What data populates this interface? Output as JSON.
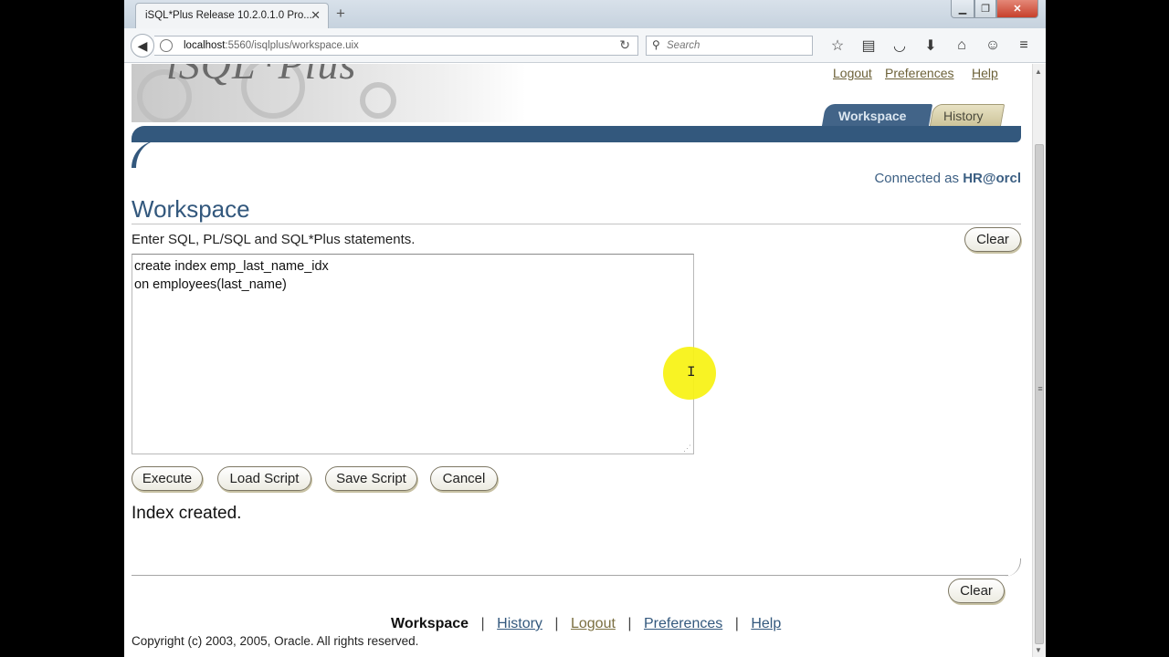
{
  "browser": {
    "tab_title": "iSQL*Plus Release 10.2.0.1.0 Pro...",
    "url_host": "localhost",
    "url_rest": ":5560/isqlplus/workspace.uix",
    "search_placeholder": "Search",
    "toolbar_icons": [
      "star-icon",
      "reading-list-icon",
      "pocket-icon",
      "download-icon",
      "home-icon",
      "chat-icon",
      "menu-icon"
    ]
  },
  "header": {
    "logo_text": "iSQL*Plus",
    "links": {
      "logout": "Logout",
      "preferences": "Preferences",
      "help": "Help"
    },
    "tabs": {
      "workspace": "Workspace",
      "history": "History"
    },
    "connected_prefix": "Connected as",
    "connected_user": "HR@orcl"
  },
  "workspace": {
    "heading": "Workspace",
    "instructions": "Enter SQL, PL/SQL and SQL*Plus statements.",
    "clear_label": "Clear",
    "sql_text": "create index emp_last_name_idx\non employees(last_name)",
    "buttons": {
      "execute": "Execute",
      "load": "Load Script",
      "save": "Save Script",
      "cancel": "Cancel"
    },
    "result": "Index created.",
    "clear_bottom_label": "Clear"
  },
  "footer": {
    "links": {
      "workspace": "Workspace",
      "history": "History",
      "logout": "Logout",
      "preferences": "Preferences",
      "help": "Help"
    },
    "separator": "|",
    "copyright": "Copyright (c) 2003, 2005, Oracle. All rights reserved."
  },
  "colors": {
    "accent": "#33587d",
    "link_tan": "#6d6239",
    "highlight": "#f7f213"
  }
}
